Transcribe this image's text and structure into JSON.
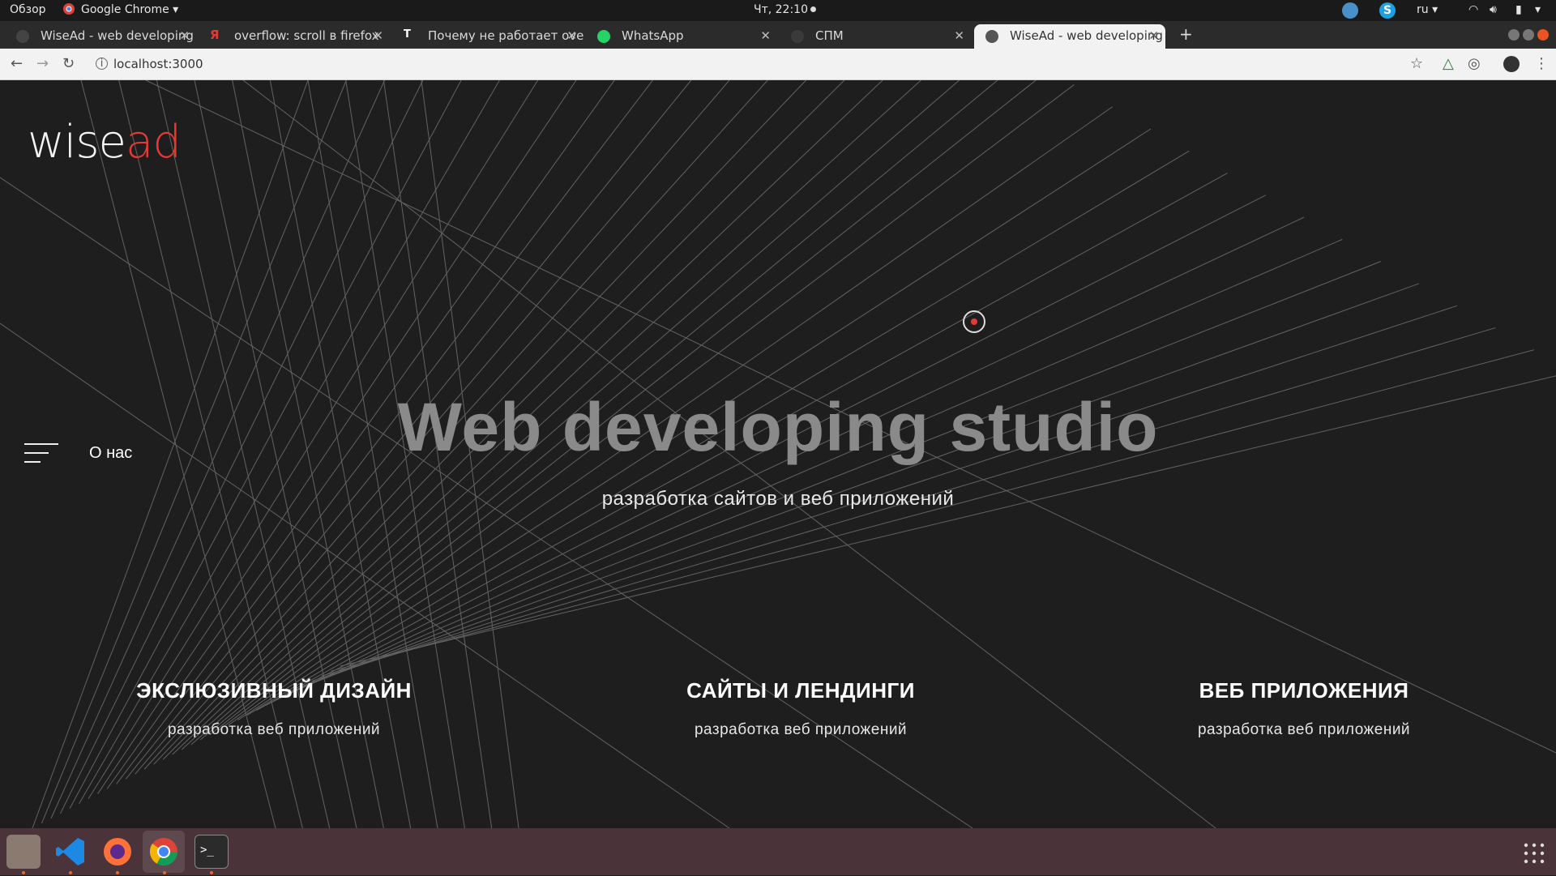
{
  "system_bar": {
    "overview": "Обзор",
    "app_name": "Google Chrome",
    "clock": "Чт, 22:10",
    "lang": "ru"
  },
  "tabs": [
    {
      "label": "WiseAd - web developing",
      "active": false
    },
    {
      "label": "overflow: scroll в firefox",
      "active": false
    },
    {
      "label": "Почему не работает over",
      "active": false
    },
    {
      "label": "WhatsApp",
      "active": false
    },
    {
      "label": "СПМ",
      "active": false
    },
    {
      "label": "WiseAd - web developing",
      "active": true
    }
  ],
  "address": {
    "url": "localhost:3000"
  },
  "page": {
    "logo_white": "wise",
    "logo_red": "ad",
    "menu_label": "О нас",
    "hero_title": "Web developing studio",
    "hero_subtitle": "разработка сайтов и веб приложений",
    "features": [
      {
        "title": "ЭКСЛЮЗИВНЫЙ ДИЗАЙН",
        "desc": "разработка веб приложений"
      },
      {
        "title": "САЙТЫ И ЛЕНДИНГИ",
        "desc": "разработка веб приложений"
      },
      {
        "title": "ВЕБ ПРИЛОЖЕНИЯ",
        "desc": "разработка веб приложений"
      }
    ]
  },
  "taskbar": {
    "apps": [
      "files-icon",
      "vscode-icon",
      "firefox-icon",
      "chrome-icon",
      "terminal-icon"
    ]
  },
  "colors": {
    "accent": "#e53935",
    "background": "#1e1e1e"
  }
}
